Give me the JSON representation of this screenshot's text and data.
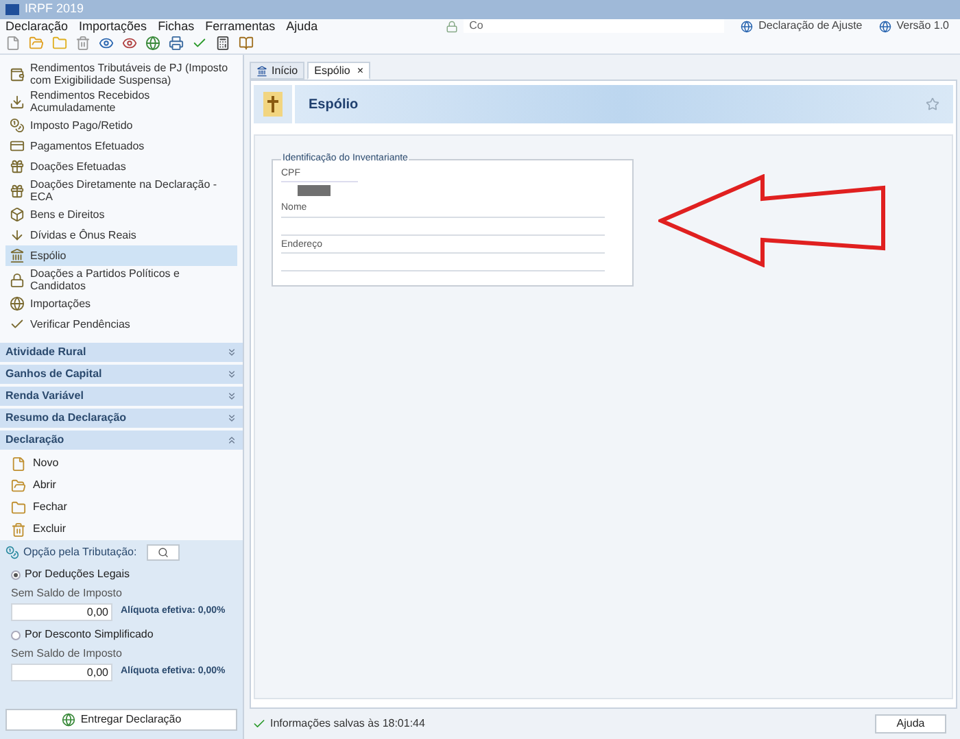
{
  "window": {
    "title": "IRPF 2019"
  },
  "menu": [
    "Declaração",
    "Importações",
    "Fichas",
    "Ferramentas",
    "Ajuda"
  ],
  "search": {
    "value": "Co"
  },
  "header_links": [
    {
      "label": "Declaração de Ajuste"
    },
    {
      "label": "Versão 1.0"
    }
  ],
  "sidebar": {
    "items": [
      {
        "label": "Rendimentos Tributáveis de PJ (Imposto com Exigibilidade Suspensa)",
        "selected": false
      },
      {
        "label": "Rendimentos Recebidos Acumuladamente",
        "selected": false
      },
      {
        "label": "Imposto Pago/Retido",
        "selected": false
      },
      {
        "label": "Pagamentos Efetuados",
        "selected": false
      },
      {
        "label": "Doações Efetuadas",
        "selected": false
      },
      {
        "label": "Doações Diretamente na Declaração - ECA",
        "selected": false
      },
      {
        "label": "Bens e Direitos",
        "selected": false
      },
      {
        "label": "Dívidas e Ônus Reais",
        "selected": false
      },
      {
        "label": "Espólio",
        "selected": true
      },
      {
        "label": "Doações a Partidos Políticos e Candidatos",
        "selected": false
      },
      {
        "label": "Importações",
        "selected": false
      },
      {
        "label": "Verificar Pendências",
        "selected": false
      }
    ],
    "sections": [
      {
        "label": "Atividade Rural",
        "expanded": false
      },
      {
        "label": "Ganhos de Capital",
        "expanded": false
      },
      {
        "label": "Renda Variável",
        "expanded": false
      },
      {
        "label": "Resumo da Declaração",
        "expanded": false
      },
      {
        "label": "Declaração",
        "expanded": true
      }
    ],
    "declaration_items": [
      "Novo",
      "Abrir",
      "Fechar",
      "Excluir"
    ]
  },
  "taxation": {
    "title": "Opção pela Tributação:",
    "options": [
      {
        "label": "Por Deduções Legais",
        "selected": true,
        "sublabel": "Sem Saldo de Imposto",
        "value": "0,00",
        "rate": "Alíquota efetiva: 0,00%"
      },
      {
        "label": "Por Desconto Simplificado",
        "selected": false,
        "sublabel": "Sem Saldo de Imposto",
        "value": "0,00",
        "rate": "Alíquota efetiva: 0,00%"
      }
    ],
    "submit": "Entregar Declaração"
  },
  "tabs": [
    {
      "label": "Início",
      "selected": false,
      "closable": false
    },
    {
      "label": "Espólio",
      "selected": true,
      "closable": true
    }
  ],
  "close_glyph": "×",
  "page": {
    "title": "Espólio",
    "group_title": "Identificação do Inventariante",
    "fields": [
      {
        "label": "CPF",
        "kind": "cpf"
      },
      {
        "label": "Nome",
        "kind": "text"
      },
      {
        "label": "Endereço",
        "kind": "text"
      }
    ]
  },
  "status": {
    "message": "Informações salvas às 18:01:44",
    "help": "Ajuda"
  }
}
